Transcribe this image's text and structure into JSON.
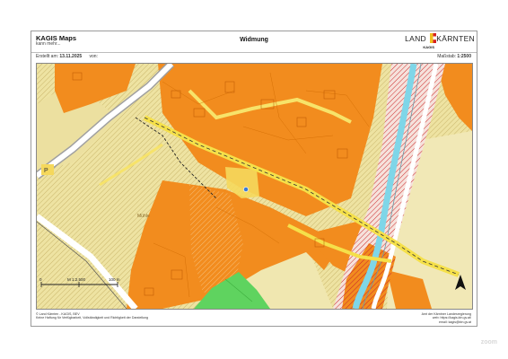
{
  "header": {
    "app_title": "KAGIS Maps",
    "app_subtitle": "kann mehr...",
    "map_title": "Widmung",
    "brand_left": "LAND",
    "brand_right": "KÄRNTEN",
    "brand_sub": "KAGIS"
  },
  "meta": {
    "created_label": "Erstellt am:",
    "created_date": "13.11.2025",
    "by_label": "von:",
    "scale_label": "Maßstab:",
    "scale_value": "1:2500"
  },
  "scalebar": {
    "start": "0",
    "middle": "M 1:2.500",
    "end": "100 m"
  },
  "map_labels": {
    "parcel_p": "P",
    "street": "Mühle"
  },
  "footer": {
    "left_line1": "© Land Kärnten - KAGIS, BEV",
    "left_line2": "Keine Haftung für Verfügbarkeit, Vollständigkeit und Richtigkeit der Darstellung",
    "right_line1": "Amt der Kärntner Landesregierung",
    "right_line2": "web: https://kagis.ktn.gv.at/",
    "right_line3": "email: kagis@ktn.gv.at"
  },
  "colors": {
    "building_land": "#f28c1e",
    "green_land": "#eee3a2",
    "park": "#5fd35f",
    "railway": "#ffffff",
    "river": "#7fd6e8",
    "traffic_area": "#f5d85c",
    "restricted_hatch": "#cc2a2a"
  },
  "watermark": "zoom"
}
